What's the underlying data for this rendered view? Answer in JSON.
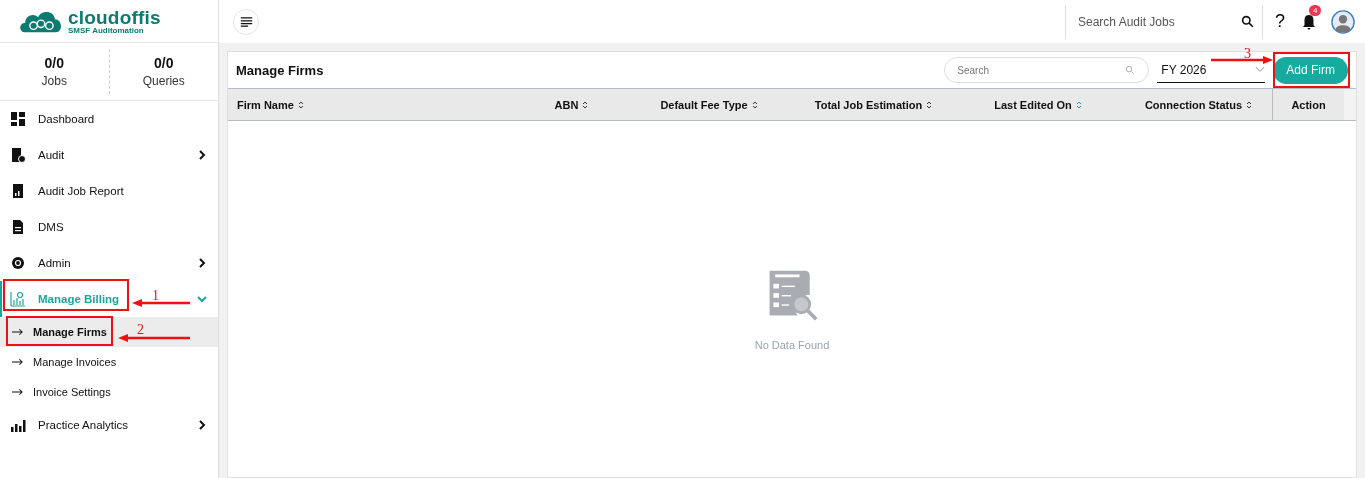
{
  "logo": {
    "name": "cloudoffis",
    "tagline": "SMSF Auditomation"
  },
  "stats": [
    {
      "value": "0/0",
      "label": "Jobs"
    },
    {
      "value": "0/0",
      "label": "Queries"
    }
  ],
  "menu": [
    {
      "label": "Dashboard",
      "selected": false
    },
    {
      "label": "Audit",
      "selected": false,
      "expanded": false
    },
    {
      "label": "Audit Job Report",
      "selected": false
    },
    {
      "label": "DMS",
      "selected": false
    },
    {
      "label": "Admin",
      "selected": false,
      "expanded": false
    },
    {
      "label": "Manage Billing",
      "selected": true,
      "expanded": true,
      "children": [
        {
          "label": "Manage Firms",
          "selected": true
        },
        {
          "label": "Manage Invoices",
          "selected": false
        },
        {
          "label": "Invoice Settings",
          "selected": false
        }
      ]
    },
    {
      "label": "Practice Analytics",
      "selected": false,
      "expanded": false
    }
  ],
  "header": {
    "search_placeholder": "Search Audit Jobs",
    "help": "?",
    "notification_count": "4"
  },
  "panel": {
    "title": "Manage Firms",
    "search_placeholder": "Search",
    "year": "FY 2026",
    "add_button": "Add Firm",
    "columns": [
      {
        "label": "Firm Name",
        "sorted": false
      },
      {
        "label": "ABN",
        "sorted": false
      },
      {
        "label": "Default Fee Type",
        "sorted": false
      },
      {
        "label": "Total Job Estimation",
        "sorted": false
      },
      {
        "label": "Last Edited On",
        "sorted": true
      },
      {
        "label": "Connection Status",
        "sorted": false
      },
      {
        "label": "Action"
      }
    ],
    "empty_text": "No Data Found"
  },
  "annotations": [
    {
      "label": "1"
    },
    {
      "label": "2"
    },
    {
      "label": "3"
    }
  ]
}
